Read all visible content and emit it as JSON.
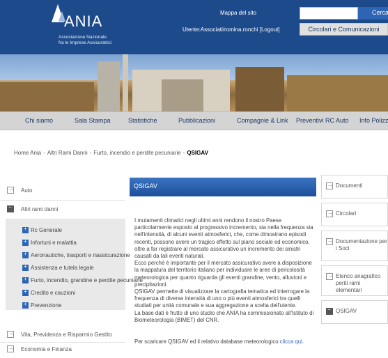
{
  "header": {
    "logo_text": "ANIA",
    "logo_sub_1": "Associazione Nazionale",
    "logo_sub_2": "fra le Imprese Assicuratrici",
    "mappa_link": "Mappa del sito",
    "utente_text": "Utente:Associati/romina.ronchi [Logout]",
    "search_placeholder": "",
    "search_button": "Cerca",
    "circolari_button": "Circolari e Comunicazioni"
  },
  "nav": {
    "items": [
      {
        "label": "Chi siamo"
      },
      {
        "label": "Sala Stampa"
      },
      {
        "label": "Statistiche"
      },
      {
        "label": "Pubblicazioni"
      },
      {
        "label": "Compagnie & Link"
      },
      {
        "label": "Preventivi RC Auto"
      },
      {
        "label": "Info Polizze"
      }
    ]
  },
  "breadcrumb": {
    "items": [
      "Home Ania",
      "Altri Rami Danni",
      "Furto, incendio e perdite pecuniarie"
    ],
    "current": "QSIGAV",
    "separator": "-"
  },
  "left_sidebar": {
    "items": [
      {
        "label": "Auto"
      },
      {
        "label": "Altri rami danni"
      },
      {
        "label": "Vita, Previdenza e Risparmio Gestito"
      },
      {
        "label": "Economia e Finanza"
      }
    ],
    "sub_items": [
      {
        "label": "Rc Generale"
      },
      {
        "label": "Infortuni e malattia"
      },
      {
        "label": "Aeronautiche, trasporti e riassicurazione"
      },
      {
        "label": "Assistenza e tutela legale"
      },
      {
        "label": "Furto, incendio, grandine e perdite pecuniarie"
      },
      {
        "label": "Credito e cauzioni"
      },
      {
        "label": "Prevenzione"
      }
    ]
  },
  "main": {
    "title": "QSIGAV",
    "paragraphs": [
      "I mutamenti climatici negli ultimi anni rendono il nostro Paese particolarmente esposto al progressivo incremento, sia nella frequenza sia nell'intensità, di alcuni eventi atmosferici, che, come dimostrano episodi recenti, possono avere un tragico effetto sul piano sociale ed economico, oltre a far registrare al mercato assicurativo un incremento dei sinistri causati da tali eventi naturali.",
      "Ecco perché è importante per il mercato assicurativo avere a disposizione la mappatura del territorio italiano per individuare le aree di pericolosità meteorologica per quanto riguarda gli eventi grandine, vento, alluvioni e precipitazioni.",
      "QSIGAV permette di visualizzare la cartografia tematica ed interrogare la frequenza di diverse intensità di uno o più eventi atmosferici tra quelli studiati per unità comunale e sua aggregazione a scelta dell'utente.",
      "La base dati è frutto di uno studio che ANIA ha commissionato all'Istituto di Biometeorologia (BIMET) del CNR."
    ],
    "download_text": "Per scaricare QSIGAV ed il relativo database meteorologico",
    "download_link": "clicca qui."
  },
  "right_sidebar": {
    "items": [
      {
        "label": "Documenti"
      },
      {
        "label": "Circolari"
      },
      {
        "label": "Documentazione per i Soci"
      },
      {
        "label": "Elenco anagrafico periti rami elementari"
      },
      {
        "label": "QSIGAV"
      }
    ]
  },
  "colors": {
    "header_blue": "#1d4a8b",
    "accent_blue": "#2d64b3",
    "nav_gray": "#d4d4d4"
  },
  "icons": {
    "expand": "arrow-square-icon",
    "collapse": "minus-square-icon",
    "sub": "plus-square-icon"
  }
}
